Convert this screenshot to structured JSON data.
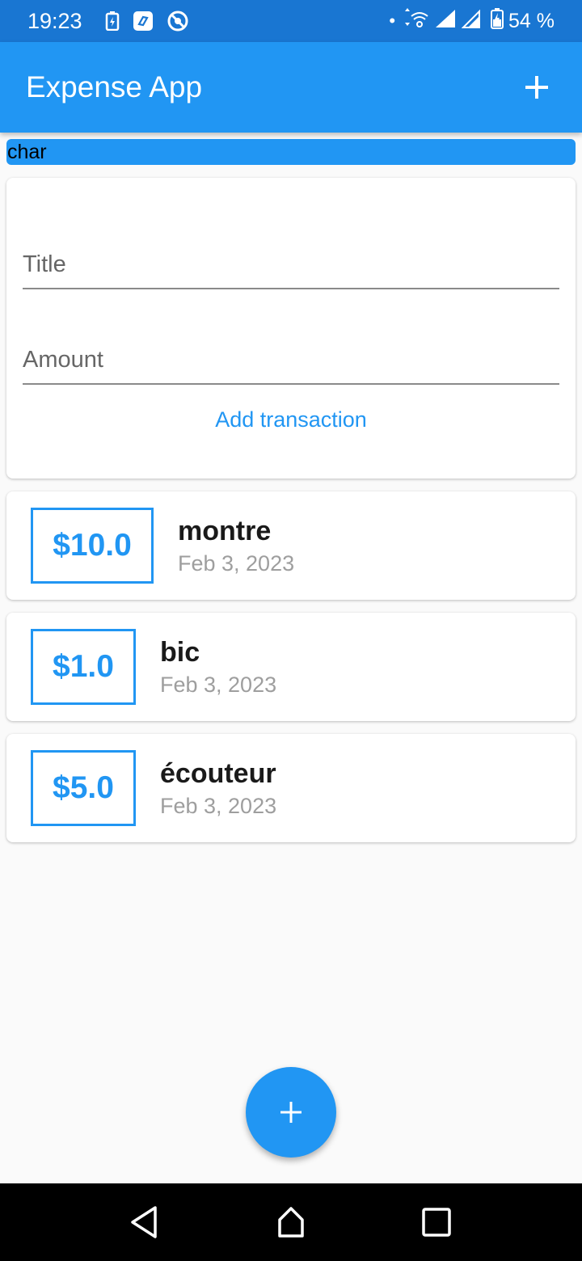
{
  "status_bar": {
    "time": "19:23",
    "battery": "54 %"
  },
  "app_bar": {
    "title": "Expense App",
    "add_icon": "plus-icon"
  },
  "chart": {
    "label": "char"
  },
  "form": {
    "title_placeholder": "Title",
    "amount_placeholder": "Amount",
    "submit_label": "Add transaction"
  },
  "transactions": [
    {
      "amount": "$10.0",
      "title": "montre",
      "date": "Feb 3, 2023"
    },
    {
      "amount": "$1.0",
      "title": "bic",
      "date": "Feb 3, 2023"
    },
    {
      "amount": "$5.0",
      "title": "écouteur",
      "date": "Feb 3, 2023"
    }
  ],
  "colors": {
    "primary": "#2196f3",
    "status_bar": "#1976d2",
    "background": "#fafafa"
  }
}
